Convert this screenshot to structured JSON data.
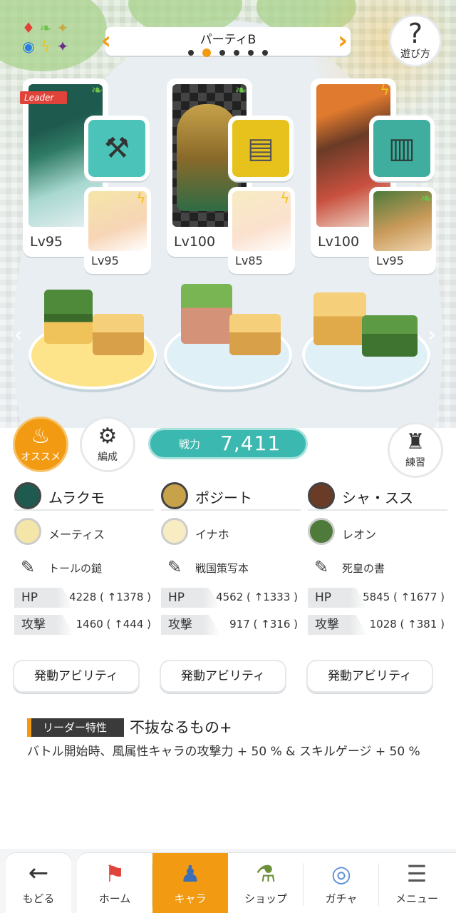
{
  "header": {
    "party_title": "パーティB",
    "page_index": 2,
    "page_count": 6,
    "help_label": "遊び方",
    "suit_icons": [
      "diamond-icon",
      "leaf-icon",
      "sparkle-icon",
      "orb-icon",
      "lightning-icon",
      "star-icon"
    ]
  },
  "leader_tag": "Leader",
  "party": [
    {
      "main": {
        "name": "ムラクモ",
        "level": "Lv95",
        "element": "leaf"
      },
      "item_icon": "hammer-icon",
      "sub": {
        "name": "メーティス",
        "level": "Lv95",
        "element": "lightning"
      },
      "item": {
        "name": "トールの鎚"
      },
      "stats": {
        "hp_label": "HP",
        "hp_value": "4228 ( ↑1378 )",
        "atk_label": "攻撃",
        "atk_value": "1460 ( ↑444 )"
      },
      "ability_button": "発動アビリティ"
    },
    {
      "main": {
        "name": "ポジート",
        "level": "Lv100",
        "element": "leaf"
      },
      "item_icon": "scroll-icon",
      "sub": {
        "name": "イナホ",
        "level": "Lv85",
        "element": "lightning"
      },
      "item": {
        "name": "戦国策写本"
      },
      "stats": {
        "hp_label": "HP",
        "hp_value": "4562 ( ↑1333 )",
        "atk_label": "攻撃",
        "atk_value": "917 ( ↑316 )"
      },
      "ability_button": "発動アビリティ"
    },
    {
      "main": {
        "name": "シャ・スス",
        "level": "Lv100",
        "element": "lightning"
      },
      "item_icon": "book-icon",
      "sub": {
        "name": "レオン",
        "level": "Lv95",
        "element": "leaf"
      },
      "item": {
        "name": "死皇の書"
      },
      "stats": {
        "hp_label": "HP",
        "hp_value": "5845 ( ↑1677 )",
        "atk_label": "攻撃",
        "atk_value": "1028 ( ↑381 )"
      },
      "ability_button": "発動アビリティ"
    }
  ],
  "actions": {
    "osusume": "オススメ",
    "hensei": "編成",
    "renshu": "練習"
  },
  "power": {
    "label": "戦力",
    "value": "7,411"
  },
  "leader_skill": {
    "label": "リーダー特性",
    "name": "不抜なるもの+",
    "description": "バトル開始時、風属性キャラの攻撃力 + 50 % & スキルゲージ + 50 %"
  },
  "nav": {
    "back": "もどる",
    "items": [
      {
        "label": "ホーム",
        "icon": "home-icon"
      },
      {
        "label": "キャラ",
        "icon": "chara-icon",
        "active": true
      },
      {
        "label": "ショップ",
        "icon": "shop-icon"
      },
      {
        "label": "ガチャ",
        "icon": "gacha-icon"
      },
      {
        "label": "メニュー",
        "icon": "menu-icon"
      }
    ]
  },
  "colors": {
    "accent": "#f29a12",
    "power": "#3bb9b0",
    "leaf": "#6cc24a",
    "lightning": "#f2c218",
    "leader": "#e0433a"
  }
}
